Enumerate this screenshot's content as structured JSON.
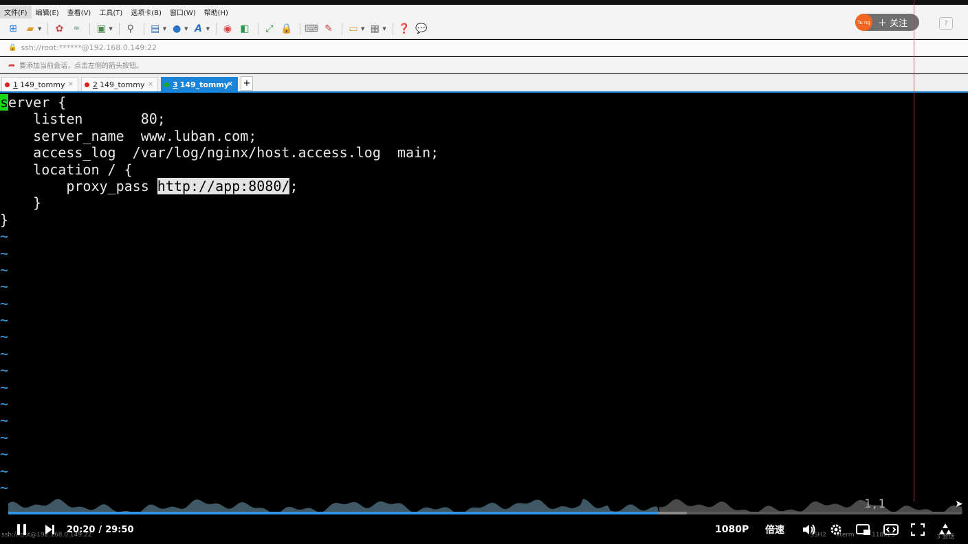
{
  "menu": [
    "文件(F)",
    "编辑(E)",
    "查看(V)",
    "工具(T)",
    "选项卡(B)",
    "窗口(W)",
    "帮助(H)"
  ],
  "address": "ssh://root:******@192.168.0.149:22",
  "hint": "要添加当前会话，点击左侧的箭头按钮。",
  "tabs": [
    {
      "num": "1",
      "label": "149_tommy",
      "status_color": "#e02020"
    },
    {
      "num": "2",
      "label": "149_tommy",
      "status_color": "#e02020"
    },
    {
      "num": "3",
      "label": "149_tommy",
      "status_color": "#16b016"
    }
  ],
  "tab_close": "×",
  "tab_add": "+",
  "follow": {
    "avatar_text": "Tu ng",
    "label": "＋ 关注"
  },
  "help_label": "?",
  "terminal": {
    "line1_cursor": "s",
    "line1_rest": "erver {",
    "line2": "    listen       80;",
    "line3": "    server_name  www.luban.com;",
    "line4": "    access_log  /var/log/nginx/host.access.log  main;",
    "line5": "    location / {",
    "line6_pre": "        proxy_pass ",
    "line6_hl": "http://app:8080/",
    "line6_post": ";",
    "line7": "    }",
    "line8": "}",
    "tilde": "~",
    "cursor_pos": "1,1"
  },
  "statusbar": {
    "conn": "ssh://root@192.168.0.149:22",
    "proto": "SSH2",
    "term": "xterm",
    "size": "118x25",
    "sessions": "3 会话"
  },
  "player": {
    "current": "20:20",
    "separator": "/",
    "total": "29:50",
    "progress": 0.682,
    "buffered": 0.712,
    "quality": "1080P",
    "speed": "倍速"
  }
}
